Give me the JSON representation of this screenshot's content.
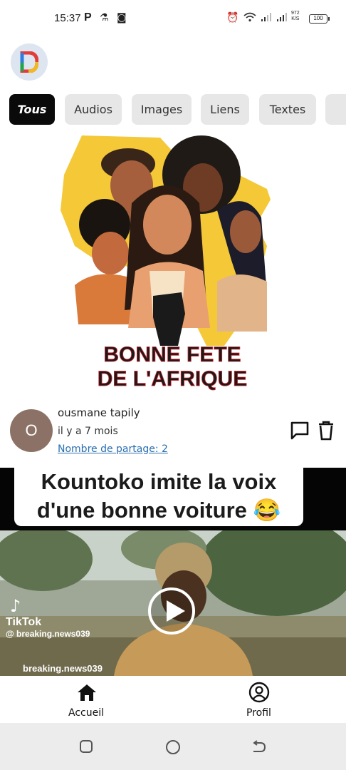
{
  "status_bar": {
    "time": "15:37",
    "left_icons": [
      "parking-icon",
      "flask-icon",
      "pin-app-icon"
    ],
    "right_icons": [
      "alarm-icon",
      "wifi-icon",
      "signal-icon",
      "signal-icon"
    ],
    "speed_value": "972",
    "speed_unit": "K/S",
    "battery": "100"
  },
  "filters": [
    {
      "label": "Tous",
      "active": true
    },
    {
      "label": "Audios",
      "active": false
    },
    {
      "label": "Images",
      "active": false
    },
    {
      "label": "Liens",
      "active": false
    },
    {
      "label": "Textes",
      "active": false
    }
  ],
  "post": {
    "image_text_line1": "BONNE FETE",
    "image_text_line2": "DE L'AFRIQUE",
    "avatar_letter": "O",
    "author": "ousmane tapily",
    "time": "il y a 7 mois",
    "shares": "Nombre de partage: 2"
  },
  "video": {
    "caption_line1": "Kountoko imite la voix",
    "caption_line2": "d'une bonne voiture 😂",
    "platform": "TikTok",
    "handle": "@ breaking.news039",
    "watermark": "breaking.news039"
  },
  "bottom_nav": {
    "home_label": "Accueil",
    "profile_label": "Profil"
  },
  "colors": {
    "accent_active_chip": "#0a0a0a",
    "chip_bg": "#e7e7e7",
    "link": "#2a6fb0",
    "avatar": "#8c7266"
  }
}
